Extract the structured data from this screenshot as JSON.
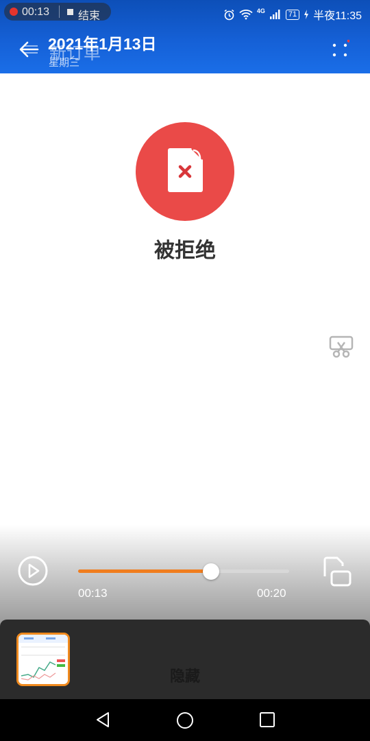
{
  "status_bar": {
    "record_time": "00:13",
    "record_end": "结束",
    "battery": "71",
    "network": "4G",
    "clock": "半夜11:35"
  },
  "header": {
    "title": "新订单",
    "date": "2021年1月13日",
    "weekday": "星期三"
  },
  "main": {
    "status_label": "被拒绝"
  },
  "player": {
    "current_time": "00:13",
    "total_time": "00:20",
    "progress": 0.63
  },
  "panel": {
    "hide_label": "隐藏"
  },
  "colors": {
    "header_blue": "#1560d6",
    "reject_red": "#ea4a48",
    "progress_orange": "#f07d1e"
  }
}
